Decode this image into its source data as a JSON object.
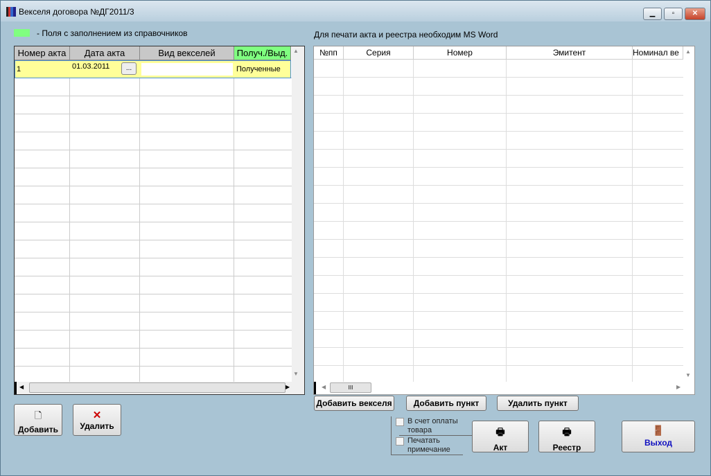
{
  "window": {
    "title": "Векселя договора №ДГ2011/3"
  },
  "legend": {
    "text": "-  Поля с заполнением из справочников",
    "color": "#80ff80"
  },
  "note": "Для печати акта и реестра необходим MS Word",
  "acts_grid": {
    "columns": [
      "Номер акта",
      "Дата акта",
      "Вид векселей",
      "Получ./Выд."
    ],
    "rows": [
      {
        "number": "1",
        "date": "01.03.2011",
        "date_button": "...",
        "type": "",
        "direction": "Полученные"
      }
    ]
  },
  "bills_grid": {
    "columns": [
      "№пп",
      "Серия",
      "Номер",
      "Эмитент",
      "Номинал ве"
    ],
    "scroll_thumb": "III"
  },
  "buttons": {
    "add": "Добавить",
    "delete": "Удалить",
    "add_bills": "Добавить векселя",
    "add_item": "Добавить пункт",
    "delete_item": "Удалить пункт",
    "act": "Акт",
    "registry": "Реестр",
    "exit": "Выход"
  },
  "checkboxes": {
    "payment": "В счет оплаты товара",
    "print_note": "Печатать примечание"
  }
}
